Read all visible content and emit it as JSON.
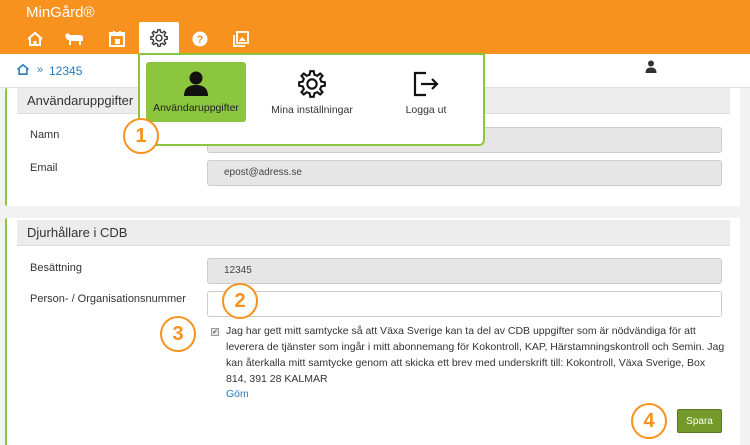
{
  "app": {
    "title": "MinGård®"
  },
  "nav": {
    "icons": [
      "home-icon",
      "cow-icon",
      "calendar-icon",
      "gear-icon",
      "help-icon",
      "gallery-icon"
    ]
  },
  "breadcrumb": {
    "separator": "»",
    "current": "12345"
  },
  "dropdown": {
    "items": [
      {
        "label": "Användaruppgifter",
        "icon": "person-icon"
      },
      {
        "label": "Mina inställningar",
        "icon": "gear-icon"
      },
      {
        "label": "Logga ut",
        "icon": "logout-icon"
      }
    ]
  },
  "user_panel": {
    "title": "Användaruppgifter",
    "name_label": "Namn",
    "name_value": "",
    "email_label": "Email",
    "email_value": "epost@adress.se"
  },
  "cdb_panel": {
    "title": "Djurhållare i CDB",
    "besattning_label": "Besättning",
    "besattning_value": "12345",
    "orgnr_label": "Person- / Organisationsnummer",
    "orgnr_value": "",
    "consent_checkmark": "✔",
    "consent_text": "Jag har gett mitt samtycke så att Växa Sverige kan ta del av CDB uppgifter som är nödvändiga för att leverera de tjänster som ingår i mitt abonnemang för Kokontroll, KAP, Härstamningskontroll och Semin. Jag kan återkalla mitt samtycke genom att skicka ett brev med underskrift till: Kokontroll, Växa Sverige, Box 814, 391 28 KALMAR",
    "hide_link": "Göm",
    "save_label": "Spara"
  },
  "callouts": [
    "1",
    "2",
    "3",
    "4"
  ],
  "colors": {
    "accent": "#f7921e",
    "green": "#8cc63f",
    "button": "#739a2a",
    "link": "#2a7ab8"
  }
}
